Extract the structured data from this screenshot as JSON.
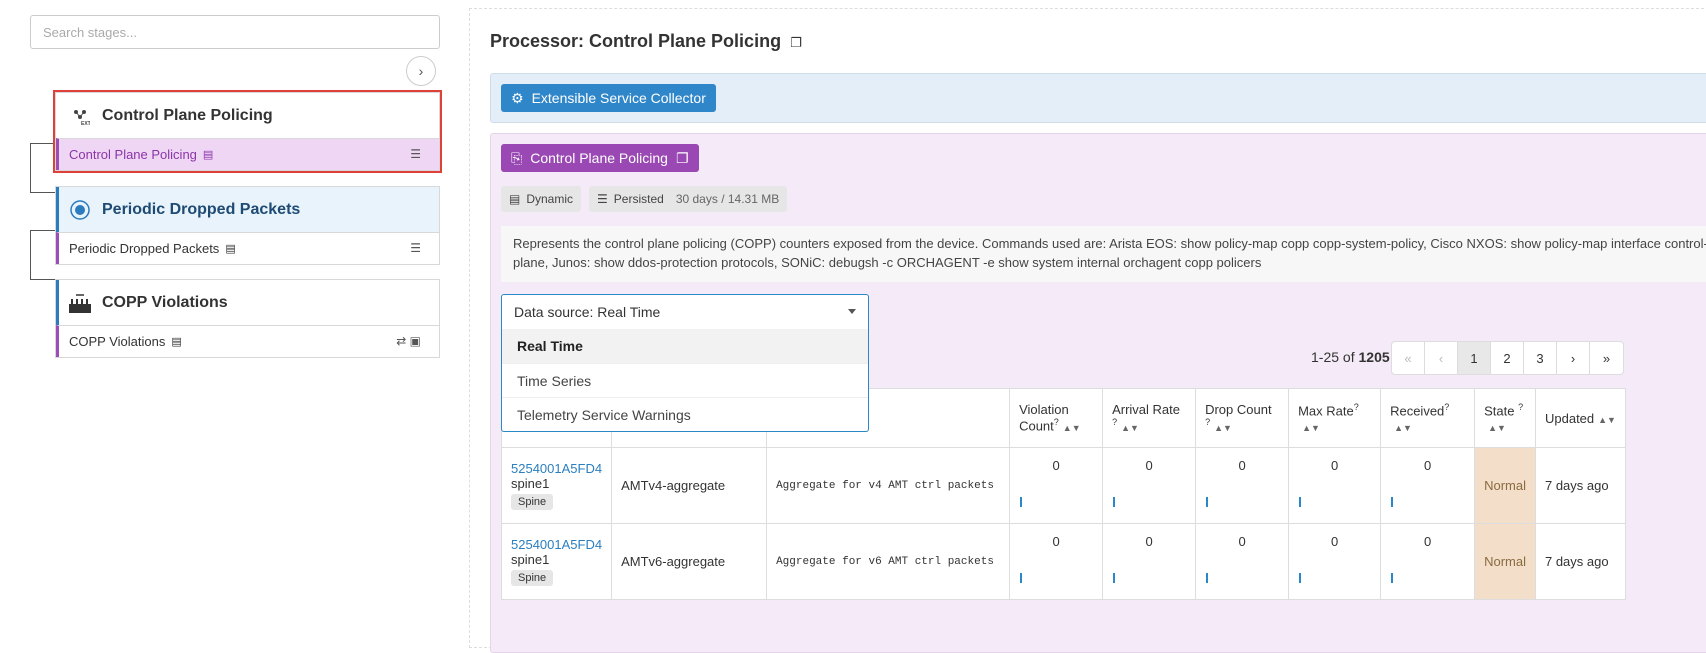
{
  "sidebar": {
    "search_placeholder": "Search stages...",
    "expand_icon": "chevron-right-icon",
    "stages": [
      {
        "title": "Control Plane Policing",
        "row_label": "Control Plane Policing"
      },
      {
        "title": "Periodic Dropped Packets",
        "row_label": "Periodic Dropped Packets"
      },
      {
        "title": "COPP Violations",
        "row_label": "COPP Violations"
      }
    ]
  },
  "main": {
    "title": "Processor: Control Plane Policing",
    "collector_label": "Extensible Service Collector",
    "processor_label": "Control Plane Policing",
    "badges": {
      "dynamic": "Dynamic",
      "persisted": "Persisted",
      "persisted_detail": "30 days / 14.31 MB"
    },
    "description": "Represents the control plane policing (COPP) counters exposed from the device. Commands used are: Arista EOS: show policy-map copp copp-system-policy, Cisco NXOS: show policy-map interface control-plane, Junos: show ddos-protection protocols, SONiC: debugsh -c ORCHAGENT -e show system internal orchagent copp policers",
    "data_source": {
      "selected": "Data source: Real Time",
      "options": [
        "Real Time",
        "Time Series",
        "Telemetry Service Warnings"
      ]
    },
    "pagination": {
      "range": "1-25",
      "of": "of",
      "total": "1205",
      "pages": [
        "1",
        "2",
        "3"
      ]
    },
    "table": {
      "headers": [
        "Violation Count",
        "Arrival Rate",
        "Drop Count",
        "Max Rate",
        "Received",
        "State",
        "Updated"
      ],
      "rows": [
        {
          "device_id": "5254001A5FD4",
          "host": "spine1",
          "role": "Spine",
          "class": "AMTv4-aggregate",
          "description": "Aggregate for v4 AMT ctrl packets",
          "violation": "0",
          "arrival": "0",
          "drop": "0",
          "max": "0",
          "received": "0",
          "state": "Normal",
          "updated": "7 days ago"
        },
        {
          "device_id": "5254001A5FD4",
          "host": "spine1",
          "role": "Spine",
          "class": "AMTv6-aggregate",
          "description": "Aggregate for v6 AMT ctrl packets",
          "violation": "0",
          "arrival": "0",
          "drop": "0",
          "max": "0",
          "received": "0",
          "state": "Normal",
          "updated": "7 days ago"
        }
      ]
    }
  },
  "colors": {
    "accent_blue": "#2f86c9",
    "processor_purple": "#9a48b3",
    "highlight_red": "#e0403a"
  }
}
